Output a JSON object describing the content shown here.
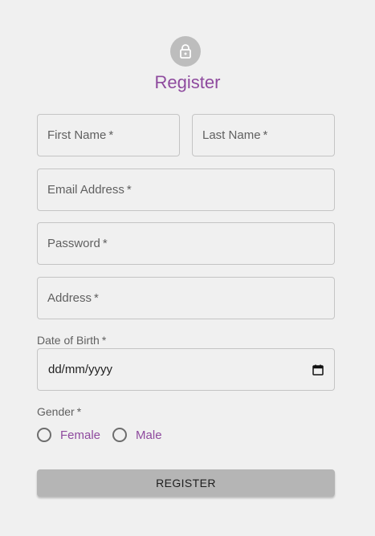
{
  "header": {
    "title": "Register",
    "icon": "lock-icon"
  },
  "fields": {
    "first_name": {
      "label": "First Name",
      "required": "*"
    },
    "last_name": {
      "label": "Last Name",
      "required": "*"
    },
    "email": {
      "label": "Email Address",
      "required": "*"
    },
    "password": {
      "label": "Password",
      "required": "*"
    },
    "address": {
      "label": "Address",
      "required": "*"
    }
  },
  "dob": {
    "label": "Date of Birth",
    "required": "*",
    "placeholder": "dd/mm/yyyy",
    "icon": "calendar-icon"
  },
  "gender": {
    "label": "Gender",
    "required": "*",
    "options": [
      "Female",
      "Male"
    ]
  },
  "submit": {
    "label": "REGISTER"
  },
  "colors": {
    "accent": "#8e4a9e",
    "button": "#b5b5b5",
    "background": "#f0f0f0"
  }
}
